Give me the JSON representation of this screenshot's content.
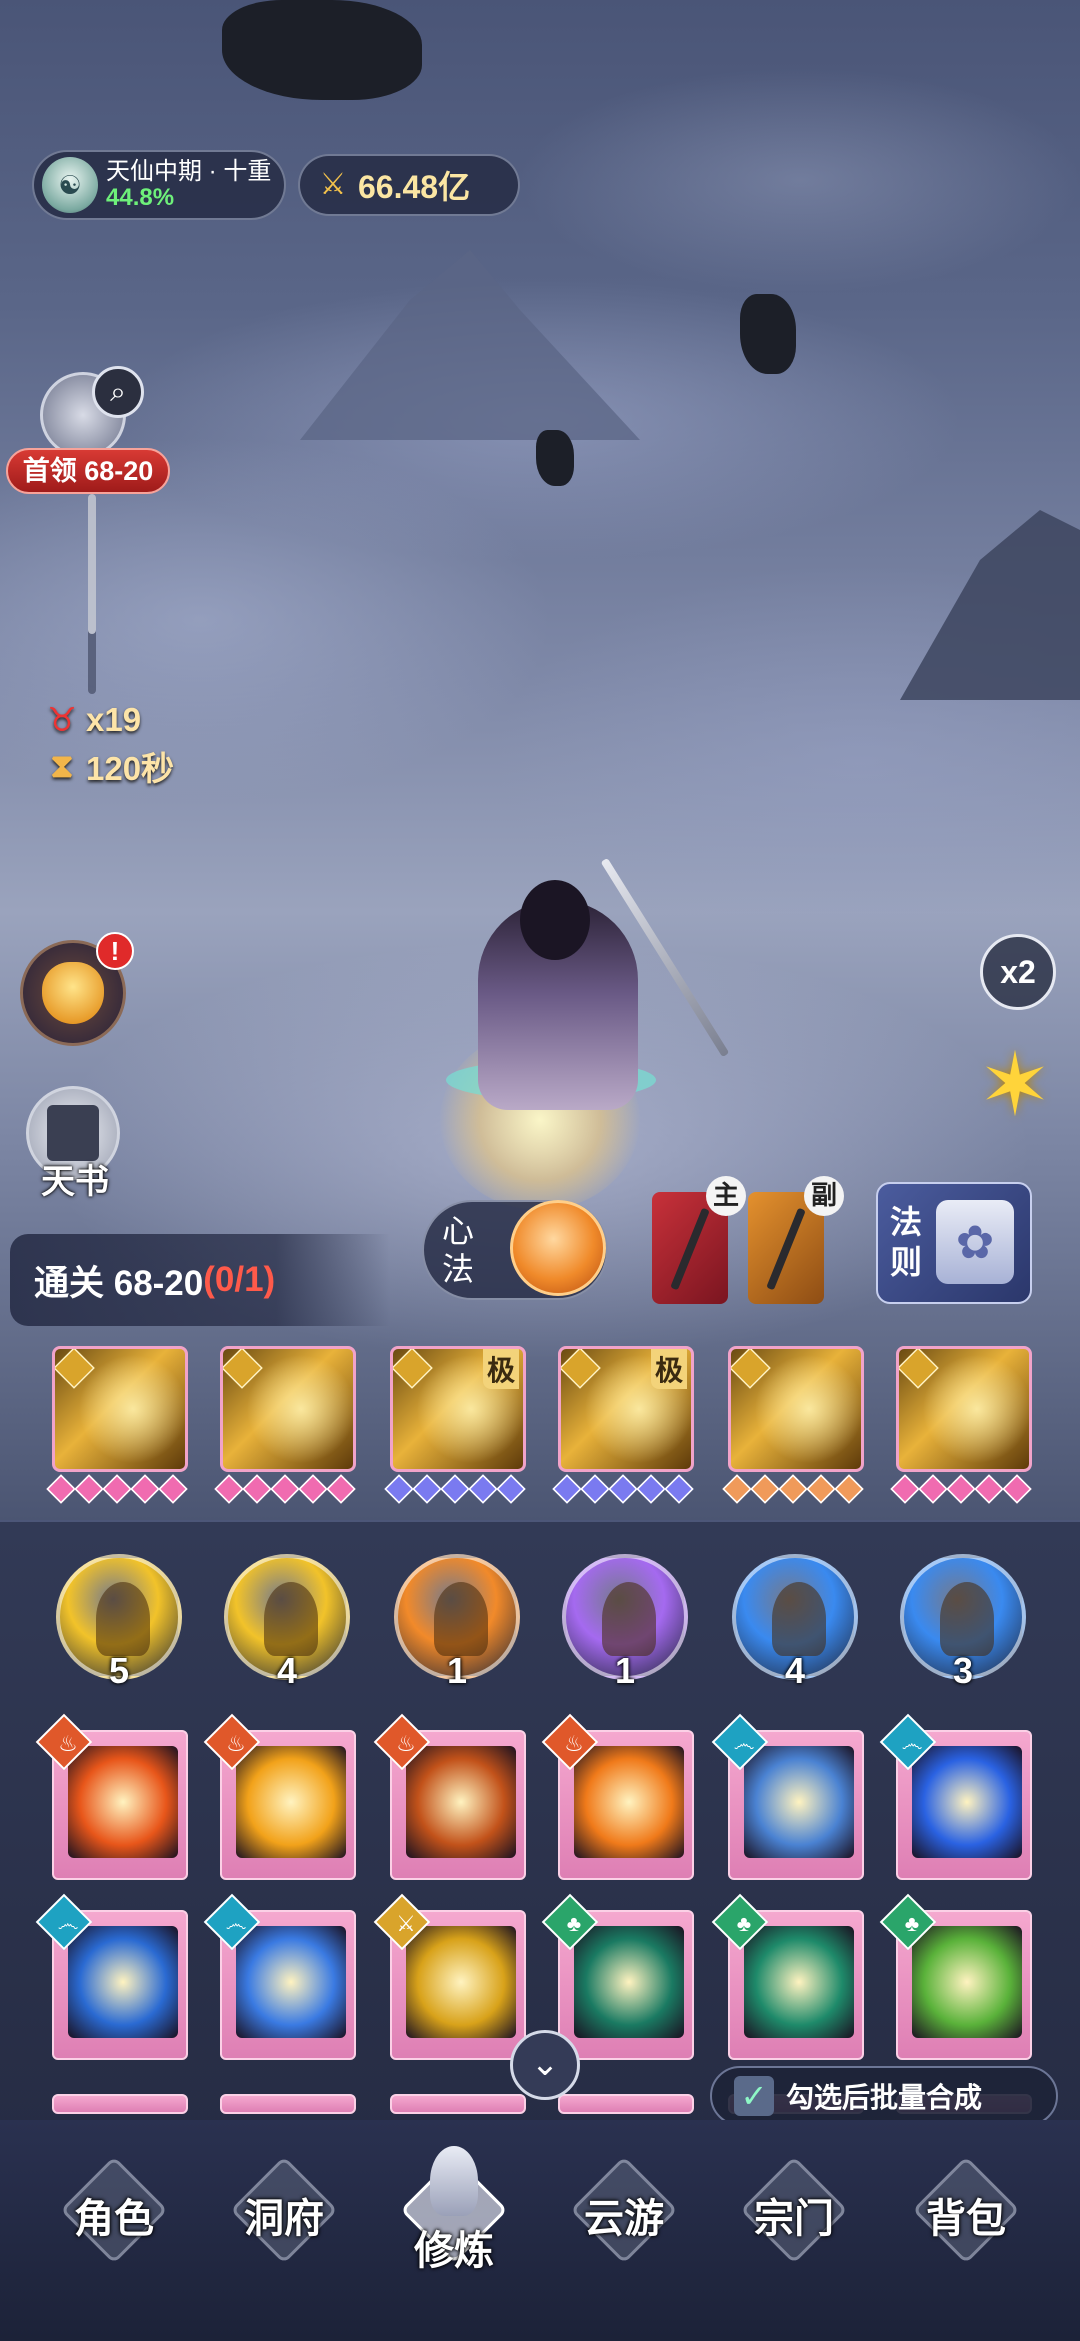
{
  "hud": {
    "realm_name": "天仙中期 · 十重",
    "realm_progress": "44.8%",
    "combat_power": "66.48亿"
  },
  "boss": {
    "label": "首领 68-20"
  },
  "stats": {
    "enemies": "x19",
    "timer": "120秒"
  },
  "left_buttons": {
    "alert": "!",
    "book_label": "天书"
  },
  "right_buttons": {
    "speed": "x2"
  },
  "stage": {
    "label": "通关 68-20",
    "progress": "(0/1)"
  },
  "xinfa": {
    "label": "心法"
  },
  "weapons": {
    "main_tag": "主",
    "sub_tag": "副"
  },
  "law": {
    "label": "法则"
  },
  "equipped_skills": [
    {
      "ji": "",
      "color": "#d9a42b",
      "gems": [
        "#f06bb0",
        "#f06bb0",
        "#f06bb0",
        "#f06bb0",
        "#f06bb0"
      ]
    },
    {
      "ji": "",
      "color": "#d9a42b",
      "gems": [
        "#f06bb0",
        "#f06bb0",
        "#f06bb0",
        "#f06bb0",
        "#f06bb0"
      ]
    },
    {
      "ji": "极",
      "color": "#d9a42b",
      "gems": [
        "#7a7af0",
        "#7a7af0",
        "#7a7af0",
        "#7a7af0",
        "#7a7af0"
      ]
    },
    {
      "ji": "极",
      "color": "#d9a42b",
      "gems": [
        "#7a7af0",
        "#7a7af0",
        "#7a7af0",
        "#7a7af0",
        "#7a7af0"
      ]
    },
    {
      "ji": "",
      "color": "#d9a42b",
      "gems": [
        "#f09a5a",
        "#f09a5a",
        "#f09a5a",
        "#f09a5a",
        "#f09a5a"
      ]
    },
    {
      "ji": "",
      "color": "#d9a42b",
      "gems": [
        "#f06bb0",
        "#f06bb0",
        "#f06bb0",
        "#f06bb0",
        "#f06bb0"
      ]
    }
  ],
  "orbs": [
    {
      "count": "5",
      "color": "#f2c32a"
    },
    {
      "count": "4",
      "color": "#f2c32a"
    },
    {
      "count": "1",
      "color": "#f28a2a"
    },
    {
      "count": "1",
      "color": "#a56af0"
    },
    {
      "count": "4",
      "color": "#3a8af0"
    },
    {
      "count": "3",
      "color": "#3a8af0"
    }
  ],
  "skill_cards": [
    {
      "element": "fire",
      "elem_color": "#e0582a",
      "art": "#e8561a"
    },
    {
      "element": "fire",
      "elem_color": "#e0582a",
      "art": "#f2a21a"
    },
    {
      "element": "fire",
      "elem_color": "#e0582a",
      "art": "#c2521a"
    },
    {
      "element": "fire",
      "elem_color": "#e0582a",
      "art": "#f07a1a"
    },
    {
      "element": "water",
      "elem_color": "#1ea2c2",
      "art": "#4a82d2"
    },
    {
      "element": "water",
      "elem_color": "#1ea2c2",
      "art": "#2a62e2"
    },
    {
      "element": "water",
      "elem_color": "#1ea2c2",
      "art": "#2a6ad2"
    },
    {
      "element": "water",
      "elem_color": "#1ea2c2",
      "art": "#3a7ae2"
    },
    {
      "element": "metal",
      "elem_color": "#d9a42b",
      "art": "#d8a21a"
    },
    {
      "element": "wood",
      "elem_color": "#2aa56a",
      "art": "#1a7a62"
    },
    {
      "element": "wood",
      "elem_color": "#2aa56a",
      "art": "#1e8a6a"
    },
    {
      "element": "wood",
      "elem_color": "#2aa56a",
      "art": "#5ab23a"
    }
  ],
  "batch": {
    "checked": true,
    "label": "勾选后批量合成"
  },
  "nav": {
    "items": [
      "角色",
      "洞府",
      "修炼",
      "云游",
      "宗门",
      "背包"
    ],
    "active": "修炼"
  }
}
